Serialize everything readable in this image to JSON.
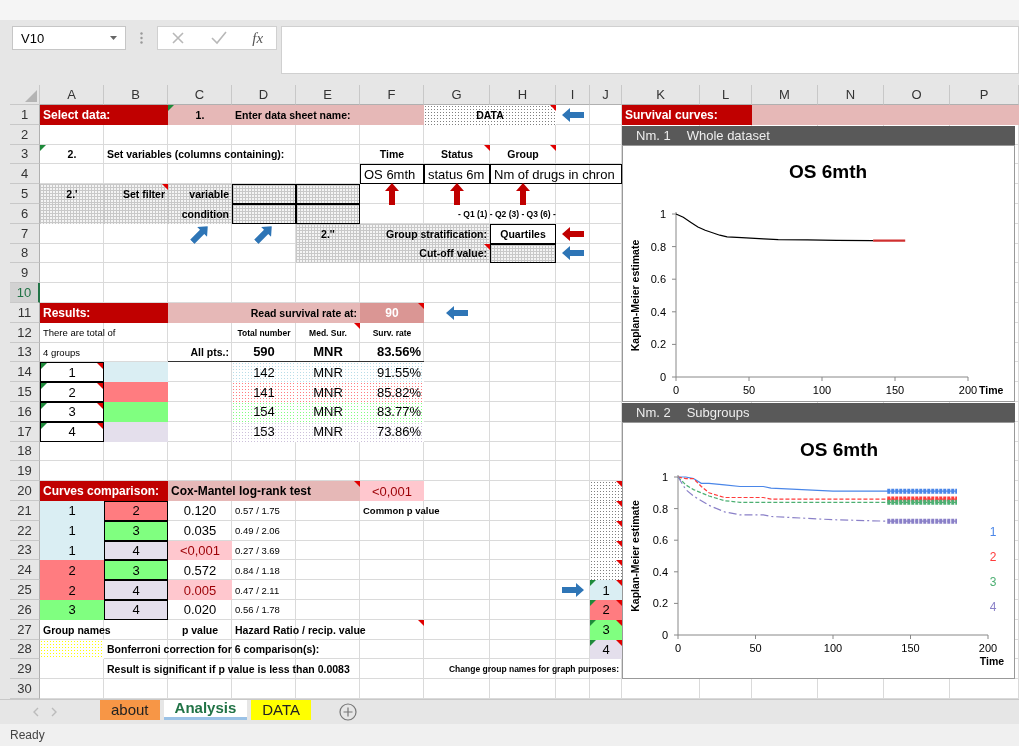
{
  "formula_bar": {
    "name_box": "V10",
    "function_symbol": "fx"
  },
  "columns": [
    "A",
    "B",
    "C",
    "D",
    "E",
    "F",
    "G",
    "H",
    "I",
    "J",
    "K",
    "L",
    "M",
    "N",
    "O",
    "P"
  ],
  "rows": [
    {
      "header": "1",
      "selected": false,
      "cells": [
        {
          "text": "Select data:",
          "kind": "title",
          "color": "#c00000"
        },
        {
          "kind": "merged"
        },
        {
          "text": "1.",
          "kind": "centered",
          "color": "#e6b8b7",
          "flag": true
        },
        {
          "text": "Enter data sheet  name:",
          "kind": "label",
          "color": "#e6b8b7"
        },
        {
          "kind": "merged"
        },
        {
          "kind": "merged"
        },
        {
          "text": "DATA",
          "kind": "centered",
          "dotted": true,
          "comment": true
        },
        {
          "kind": "merged"
        },
        {
          "kind": "leftarrow",
          "color": "#2e75b6"
        },
        null,
        {
          "text": "Survival curves:",
          "kind": "title",
          "color": "#c00000"
        },
        {
          "kind": "merged"
        },
        {
          "kind": "swatch",
          "color": "#e6b8b7"
        },
        {
          "kind": "merged"
        },
        {
          "kind": "merged"
        },
        {
          "kind": "merged"
        }
      ]
    },
    {
      "header": "2",
      "selected": false
    },
    {
      "header": "3",
      "selected": false,
      "cells": [
        {
          "text": "2.",
          "kind": "centered",
          "flag": true
        },
        {
          "text": "Set variables (columns containing):",
          "kind": "label"
        },
        {
          "kind": "merged"
        },
        {
          "kind": "merged"
        },
        {
          "kind": "merged"
        },
        {
          "text": "Time",
          "kind": "centered"
        },
        {
          "text": "Status",
          "kind": "centered",
          "comment": true
        },
        {
          "text": "Group",
          "kind": "centered",
          "comment": true
        }
      ]
    },
    {
      "header": "4",
      "selected": false,
      "cells": [
        null,
        null,
        null,
        null,
        null,
        {
          "text": "OS 6mth",
          "kind": "entry",
          "boxed": true
        },
        {
          "text": "status 6m",
          "kind": "entry",
          "boxed": true
        },
        {
          "text": "Nm of drugs in chron",
          "kind": "entry",
          "boxed": true
        },
        {
          "kind": "merged"
        },
        {
          "kind": "merged"
        }
      ]
    },
    {
      "header": "5",
      "selected": false,
      "cells": [
        {
          "text": "2.'",
          "kind": "centered",
          "hatched": true
        },
        {
          "text": "Set filter",
          "kind": "prompt",
          "hatched": true,
          "comment": true
        },
        {
          "text": "variable",
          "kind": "prompt",
          "hatched": true
        },
        {
          "kind": "swatch",
          "hatched": true,
          "boxed": true
        },
        {
          "kind": "swatch",
          "hatched": true,
          "boxed": true
        },
        {
          "kind": "uparrow",
          "color": "#c00000"
        },
        {
          "kind": "uparrow",
          "color": "#c00000"
        },
        {
          "kind": "uparrow",
          "color": "#c00000"
        }
      ]
    },
    {
      "header": "6",
      "selected": false,
      "cells": [
        {
          "kind": "swatch",
          "hatched": true
        },
        {
          "kind": "swatch",
          "hatched": true
        },
        {
          "text": "condition",
          "kind": "prompt",
          "hatched": true
        },
        {
          "kind": "swatch",
          "hatched": true,
          "boxed": true
        },
        {
          "kind": "swatch",
          "hatched": true,
          "boxed": true
        },
        null,
        {
          "text": "- Q1 (1) - Q2 (3) - Q3 (6) -",
          "kind": "caption"
        },
        {
          "kind": "merged"
        },
        {
          "kind": "merged"
        }
      ]
    },
    {
      "header": "7",
      "selected": false,
      "cells": [
        null,
        null,
        {
          "kind": "diagarrow",
          "color": "#2e75b6"
        },
        {
          "kind": "diagarrow",
          "color": "#2e75b6"
        },
        {
          "text": "2.''",
          "kind": "centered",
          "hatched": true
        },
        {
          "text": "Group stratification:",
          "kind": "prompt",
          "hatched": true
        },
        {
          "kind": "merged"
        },
        {
          "text": "Quartiles",
          "kind": "centered",
          "boxed": true
        },
        {
          "kind": "leftarrow",
          "color": "#c00000"
        }
      ]
    },
    {
      "header": "8",
      "selected": false,
      "cells": [
        null,
        null,
        null,
        null,
        {
          "kind": "swatch",
          "hatched": true
        },
        {
          "text": "Cut-off value:",
          "kind": "prompt",
          "hatched": true,
          "comment": true
        },
        {
          "kind": "merged"
        },
        {
          "kind": "swatch",
          "hatched": true,
          "boxed": true
        },
        {
          "kind": "leftarrow",
          "color": "#2e75b6"
        }
      ]
    },
    {
      "header": "9",
      "selected": false
    },
    {
      "header": "10",
      "selected": true
    },
    {
      "header": "11",
      "selected": false,
      "cells": [
        {
          "text": "Results:",
          "kind": "title",
          "color": "#c00000"
        },
        {
          "kind": "merged"
        },
        {
          "text": "Read survival rate at:",
          "kind": "prompt",
          "color": "#e6b8b7"
        },
        {
          "kind": "merged"
        },
        {
          "kind": "merged"
        },
        {
          "text": "90",
          "kind": "input",
          "color": "#da9694",
          "comment": true
        },
        {
          "kind": "leftarrow",
          "color": "#2e75b6"
        }
      ]
    },
    {
      "header": "12",
      "selected": false,
      "cells": [
        {
          "text": "There are total of",
          "kind": "note"
        },
        {
          "kind": "merged"
        },
        null,
        {
          "text": "Total number",
          "kind": "caption"
        },
        {
          "text": "Med. Sur.",
          "kind": "caption",
          "comment": true
        },
        {
          "text": "Surv. rate",
          "kind": "caption"
        }
      ]
    },
    {
      "header": "13",
      "selected": false,
      "cells": [
        {
          "text": "4 groups",
          "kind": "note"
        },
        {
          "kind": "merged"
        },
        {
          "text": "All pts.:",
          "kind": "prompt",
          "rule": true
        },
        {
          "text": "590",
          "kind": "total",
          "rule": true
        },
        {
          "text": "MNR",
          "kind": "total",
          "rule": true
        },
        {
          "text": "83.56%",
          "kind": "totalright",
          "rule": true
        }
      ]
    },
    {
      "header": "14",
      "selected": false,
      "cells": [
        {
          "text": "1",
          "kind": "value",
          "boxed": true,
          "flag": true,
          "comment": true
        },
        {
          "kind": "swatch",
          "color": "#daeef3"
        },
        null,
        {
          "text": "142",
          "kind": "value",
          "dotted": true,
          "color": "#b7dde8"
        },
        {
          "text": "MNR",
          "kind": "value",
          "dotted": true,
          "color": "#b7dde8"
        },
        {
          "text": "91.55%",
          "kind": "percent",
          "dotted": true,
          "color": "#b7dde8"
        }
      ]
    },
    {
      "header": "15",
      "selected": false,
      "cells": [
        {
          "text": "2",
          "kind": "value",
          "boxed": true,
          "flag": true,
          "comment": true
        },
        {
          "kind": "swatch",
          "color": "#ff7c80"
        },
        null,
        {
          "text": "141",
          "kind": "value",
          "dotted": true,
          "color": "#ff7c80"
        },
        {
          "text": "MNR",
          "kind": "value",
          "dotted": true,
          "color": "#ff7c80"
        },
        {
          "text": "85.82%",
          "kind": "percent",
          "dotted": true,
          "color": "#ff7c80"
        }
      ]
    },
    {
      "header": "16",
      "selected": false,
      "cells": [
        {
          "text": "3",
          "kind": "value",
          "boxed": true,
          "flag": true,
          "comment": true
        },
        {
          "kind": "swatch",
          "color": "#80ff80"
        },
        null,
        {
          "text": "154",
          "kind": "value",
          "dotted": true,
          "color": "#80ff80"
        },
        {
          "text": "MNR",
          "kind": "value",
          "dotted": true,
          "color": "#80ff80"
        },
        {
          "text": "83.77%",
          "kind": "percent",
          "dotted": true,
          "color": "#80ff80"
        }
      ]
    },
    {
      "header": "17",
      "selected": false,
      "cells": [
        {
          "text": "4",
          "kind": "value",
          "boxed": true,
          "flag": true,
          "comment": true
        },
        {
          "kind": "swatch",
          "color": "#e4dfec"
        },
        null,
        {
          "text": "153",
          "kind": "value",
          "dotted": true,
          "color": "#ccc0da"
        },
        {
          "text": "MNR",
          "kind": "value",
          "dotted": true,
          "color": "#ccc0da"
        },
        {
          "text": "73.86%",
          "kind": "percent",
          "dotted": true,
          "color": "#ccc0da"
        }
      ]
    },
    {
      "header": "18",
      "selected": false
    },
    {
      "header": "19",
      "selected": false
    },
    {
      "header": "20",
      "selected": false,
      "cells": [
        {
          "text": "Curves comparison:",
          "kind": "title",
          "color": "#c00000"
        },
        {
          "kind": "merged"
        },
        {
          "text": "Cox-Mantel log-rank test",
          "kind": "heading",
          "color": "#e6b8b7",
          "comment": true
        },
        {
          "kind": "merged"
        },
        {
          "kind": "merged"
        },
        {
          "text": "<0,001",
          "kind": "alert",
          "color": "#ffc7ce"
        },
        null,
        null,
        null,
        {
          "kind": "swatch",
          "dotted": true,
          "comment": true
        }
      ]
    },
    {
      "header": "21",
      "selected": false,
      "cells": [
        {
          "text": "1",
          "kind": "value",
          "color": "#daeef3"
        },
        {
          "text": "2",
          "kind": "value",
          "color": "#ff7c80",
          "boxed": true
        },
        {
          "text": "0.120",
          "kind": "value"
        },
        {
          "text": "0.57 / 1.75",
          "kind": "note"
        },
        null,
        {
          "text": "Common p value",
          "kind": "remark"
        },
        {
          "kind": "merged"
        },
        null,
        null,
        {
          "kind": "swatch",
          "dotted": true,
          "comment": true
        }
      ]
    },
    {
      "header": "22",
      "selected": false,
      "cells": [
        {
          "text": "1",
          "kind": "value",
          "color": "#daeef3"
        },
        {
          "text": "3",
          "kind": "value",
          "color": "#80ff80",
          "boxed": true
        },
        {
          "text": "0.035",
          "kind": "value"
        },
        {
          "text": "0.49 / 2.06",
          "kind": "note"
        },
        null,
        null,
        null,
        null,
        null,
        {
          "kind": "swatch",
          "dotted": true,
          "comment": true
        }
      ]
    },
    {
      "header": "23",
      "selected": false,
      "cells": [
        {
          "text": "1",
          "kind": "value",
          "color": "#daeef3"
        },
        {
          "text": "4",
          "kind": "value",
          "color": "#e4dfec",
          "boxed": true
        },
        {
          "text": "<0,001",
          "kind": "alert",
          "color": "#ffc7ce"
        },
        {
          "text": "0.27 / 3.69",
          "kind": "note"
        },
        null,
        null,
        null,
        null,
        null,
        {
          "kind": "swatch",
          "dotted": true,
          "comment": true
        }
      ]
    },
    {
      "header": "24",
      "selected": false,
      "cells": [
        {
          "text": "2",
          "kind": "value",
          "color": "#ff7c80"
        },
        {
          "text": "3",
          "kind": "value",
          "color": "#80ff80",
          "boxed": true
        },
        {
          "text": "0.572",
          "kind": "value"
        },
        {
          "text": "0.84 / 1.18",
          "kind": "note"
        },
        null,
        null,
        null,
        null,
        null,
        {
          "kind": "swatch",
          "dotted": true,
          "comment": true
        }
      ]
    },
    {
      "header": "25",
      "selected": false,
      "cells": [
        {
          "text": "2",
          "kind": "value",
          "color": "#ff7c80"
        },
        {
          "text": "4",
          "kind": "value",
          "color": "#e4dfec",
          "boxed": true
        },
        {
          "text": "0.005",
          "kind": "alert",
          "color": "#ffc7ce"
        },
        {
          "text": "0.47 / 2.11",
          "kind": "note"
        },
        null,
        null,
        null,
        null,
        {
          "kind": "rightarrow",
          "color": "#2e75b6"
        },
        {
          "text": "1",
          "kind": "value",
          "color": "#daeef3",
          "flag": true,
          "comment": true
        }
      ]
    },
    {
      "header": "26",
      "selected": false,
      "cells": [
        {
          "text": "3",
          "kind": "value",
          "color": "#80ff80"
        },
        {
          "text": "4",
          "kind": "value",
          "color": "#e4dfec",
          "boxed": true
        },
        {
          "text": "0.020",
          "kind": "value"
        },
        {
          "text": "0.56 / 1.78",
          "kind": "note"
        },
        null,
        null,
        null,
        null,
        null,
        {
          "text": "2",
          "kind": "value",
          "color": "#ff7c80",
          "flag": true,
          "comment": true
        }
      ]
    },
    {
      "header": "27",
      "selected": false,
      "cells": [
        {
          "text": "Group names",
          "kind": "label"
        },
        {
          "kind": "merged"
        },
        {
          "text": "p value",
          "kind": "centered"
        },
        {
          "text": "Hazard Ratio / recip. value",
          "kind": "label",
          "comment": true
        },
        {
          "kind": "merged"
        },
        {
          "kind": "merged"
        },
        null,
        null,
        null,
        {
          "text": "3",
          "kind": "value",
          "color": "#80ff80",
          "flag": true,
          "comment": true
        }
      ]
    },
    {
      "header": "28",
      "selected": false,
      "cells": [
        {
          "kind": "swatch",
          "color": "#ffff00",
          "dotted": true
        },
        {
          "text": "Bonferroni correction for 6 comparison(s):",
          "kind": "label"
        },
        {
          "kind": "merged"
        },
        {
          "kind": "merged"
        },
        {
          "kind": "merged"
        },
        {
          "kind": "merged"
        },
        null,
        null,
        null,
        {
          "text": "4",
          "kind": "value",
          "color": "#e4dfec",
          "flag": true,
          "comment": true
        }
      ]
    },
    {
      "header": "29",
      "selected": false,
      "cells": [
        null,
        {
          "text": "Result is significant if p value is less than 0.0083",
          "kind": "label"
        },
        {
          "kind": "merged"
        },
        {
          "kind": "merged"
        },
        {
          "kind": "merged"
        },
        {
          "kind": "merged"
        },
        {
          "text": "Change group names for graph purposes:",
          "kind": "footnote"
        },
        {
          "kind": "merged"
        },
        {
          "kind": "merged"
        },
        {
          "kind": "merged"
        }
      ]
    },
    {
      "header": "30",
      "selected": false
    }
  ],
  "charts": [
    {
      "number": "Nm. 1",
      "caption": "Whole dataset",
      "chart_data": {
        "type": "line",
        "title": "OS 6mth",
        "xlabel": "Time",
        "ylabel": "Kaplan-Meier estimate",
        "xlim": [
          0,
          200
        ],
        "ylim": [
          0,
          1
        ],
        "xticks": [
          0,
          50,
          100,
          150,
          200
        ],
        "yticks": [
          0,
          0.2,
          0.4,
          0.6,
          0.8,
          1
        ],
        "x": [
          0,
          5,
          10,
          15,
          20,
          25,
          30,
          35,
          45,
          60,
          70,
          90,
          110,
          135,
          157
        ],
        "series": [
          {
            "color": "#000000",
            "values": [
              1,
              0.98,
              0.95,
              0.92,
              0.9,
              0.885,
              0.87,
              0.86,
              0.855,
              0.847,
              0.843,
              0.842,
              0.838,
              0.836,
              null
            ]
          },
          {
            "color": "#d03030",
            "values": [
              null,
              null,
              null,
              null,
              null,
              null,
              null,
              null,
              null,
              null,
              null,
              null,
              null,
              0.836,
              0.836
            ]
          }
        ]
      }
    },
    {
      "number": "Nm. 2",
      "caption": "Subgroups",
      "chart_data": {
        "type": "line",
        "title": "OS 6mth",
        "xlabel": "Time",
        "ylabel": "Kaplan-Meier estimate",
        "xlim": [
          0,
          200
        ],
        "ylim": [
          0,
          1
        ],
        "xticks": [
          0,
          50,
          100,
          150,
          200
        ],
        "yticks": [
          0,
          0.2,
          0.4,
          0.6,
          0.8,
          1
        ],
        "legend": true,
        "x": [
          0,
          5,
          10,
          15,
          20,
          30,
          40,
          55,
          60,
          80,
          100,
          135,
          180
        ],
        "series": [
          {
            "name": "1",
            "color": "#4a86e8",
            "values": [
              1,
              1,
              0.99,
              0.96,
              0.96,
              0.95,
              0.94,
              0.94,
              0.93,
              0.92,
              0.91,
              0.91,
              0.91
            ]
          },
          {
            "name": "2",
            "color": "#ff3b3b",
            "line_style": "dashed",
            "values": [
              1,
              0.99,
              0.99,
              0.94,
              0.9,
              0.87,
              0.87,
              0.87,
              0.86,
              0.86,
              0.86,
              0.86,
              0.86
            ]
          },
          {
            "name": "3",
            "color": "#4caf72",
            "line_style": "dashed",
            "values": [
              1,
              0.95,
              0.92,
              0.9,
              0.88,
              0.85,
              0.84,
              0.84,
              0.84,
              0.84,
              0.84,
              0.84,
              0.84
            ]
          },
          {
            "name": "4",
            "color": "#8a80c8",
            "line_style": "dashdot",
            "values": [
              1,
              0.92,
              0.88,
              0.85,
              0.82,
              0.78,
              0.76,
              0.76,
              0.75,
              0.74,
              0.73,
              0.72,
              0.72
            ]
          }
        ]
      }
    }
  ],
  "sheet_tabs": [
    {
      "label": "about",
      "selected": false,
      "color": "#f79646"
    },
    {
      "label": "Analysis",
      "selected": true,
      "color": "#9bc2e6"
    },
    {
      "label": "DATA",
      "selected": false,
      "color": "#ffff00"
    }
  ],
  "status_bar": {
    "text": "Ready"
  }
}
